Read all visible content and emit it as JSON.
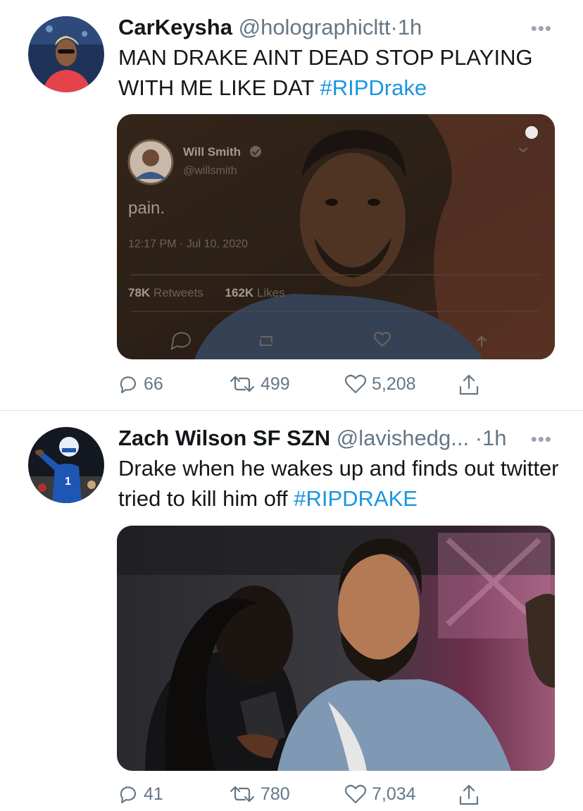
{
  "tweets": [
    {
      "name": "CarKeysha",
      "handle": "@holographicltt",
      "separator": "·",
      "time": "1h",
      "more": "•••",
      "text": "MAN DRAKE AINT DEAD STOP PLAYING WITH ME LIKE DAT ",
      "hashtag": "#RIPDrake",
      "embedded_tweet": {
        "name": "Will Smith",
        "handle": "@willsmith",
        "text": "pain.",
        "time": "12:17 PM · Jul 10, 2020",
        "retweets_count": "78K",
        "retweets_label": "Retweets",
        "likes_count": "162K",
        "likes_label": "Likes"
      },
      "replies": "66",
      "retweets": "499",
      "likes": "5,208"
    },
    {
      "name": "Zach Wilson SF SZN",
      "handle": "@lavishedg...",
      "separator": "·",
      "time": "1h",
      "more": "•••",
      "text": "Drake when he wakes up and finds out twitter tried to kill him off ",
      "hashtag": "#RIPDRAKE",
      "replies": "41",
      "retweets": "780",
      "likes": "7,034"
    }
  ],
  "colors": {
    "link": "#1b95e0",
    "secondary": "#657786",
    "divider": "#dfe3e6"
  },
  "icons": [
    "reply-icon",
    "retweet-icon",
    "like-icon",
    "share-icon",
    "more-icon"
  ]
}
